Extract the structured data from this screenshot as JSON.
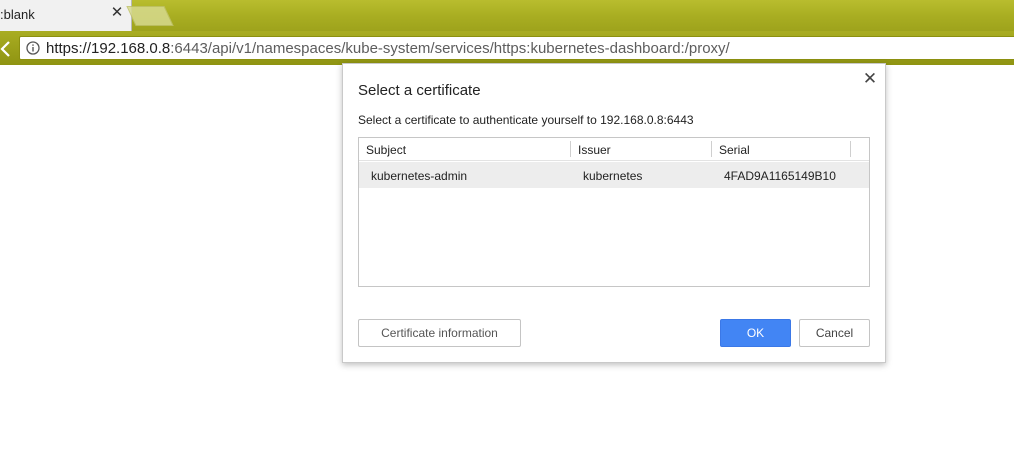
{
  "browser": {
    "tab": {
      "title": ":blank",
      "close_glyph": "✕"
    },
    "address_bar": {
      "url_host": "https://192.168.0.8",
      "url_rest": ":6443/api/v1/namespaces/kube-system/services/https:kubernetes-dashboard:/proxy/",
      "icon": "info-icon"
    },
    "theme_color": "#a9ae22"
  },
  "dialog": {
    "title": "Select a certificate",
    "description": "Select a certificate to authenticate yourself to 192.168.0.8:6443",
    "close_glyph": "✕",
    "table": {
      "headers": [
        "Subject",
        "Issuer",
        "Serial"
      ],
      "rows": [
        {
          "subject": "kubernetes-admin",
          "issuer": "kubernetes",
          "serial": "4FAD9A1165149B10",
          "selected": true
        }
      ]
    },
    "buttons": {
      "info": "Certificate information",
      "ok": "OK",
      "cancel": "Cancel"
    },
    "colors": {
      "primary": "#4285f4",
      "selected_row": "#ededed"
    }
  }
}
